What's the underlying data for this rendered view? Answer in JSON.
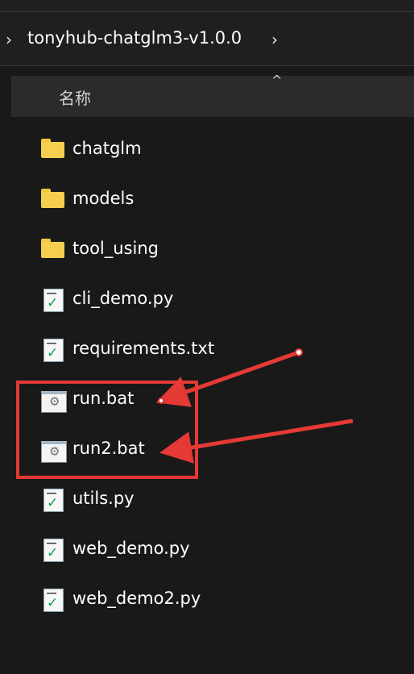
{
  "address_bar": {
    "path": "tonyhub-chatglm3-v1.0.0",
    "chevron_left_icon": "chevron-right",
    "chevron_right_icon": "chevron-right"
  },
  "list": {
    "column_header": "名称",
    "sort_indicator": "^",
    "items": [
      {
        "name": "chatglm",
        "icon": "folder-icon"
      },
      {
        "name": "models",
        "icon": "folder-icon"
      },
      {
        "name": "tool_using",
        "icon": "folder-icon"
      },
      {
        "name": "cli_demo.py",
        "icon": "python-file-icon"
      },
      {
        "name": "requirements.txt",
        "icon": "text-file-icon"
      },
      {
        "name": "run.bat",
        "icon": "batch-file-icon"
      },
      {
        "name": "run2.bat",
        "icon": "batch-file-icon"
      },
      {
        "name": "utils.py",
        "icon": "python-file-icon"
      },
      {
        "name": "web_demo.py",
        "icon": "python-file-icon"
      },
      {
        "name": "web_demo2.py",
        "icon": "python-file-icon"
      }
    ]
  },
  "annotation": {
    "highlight_color": "#e53935",
    "arrow_color": "#e53935"
  }
}
